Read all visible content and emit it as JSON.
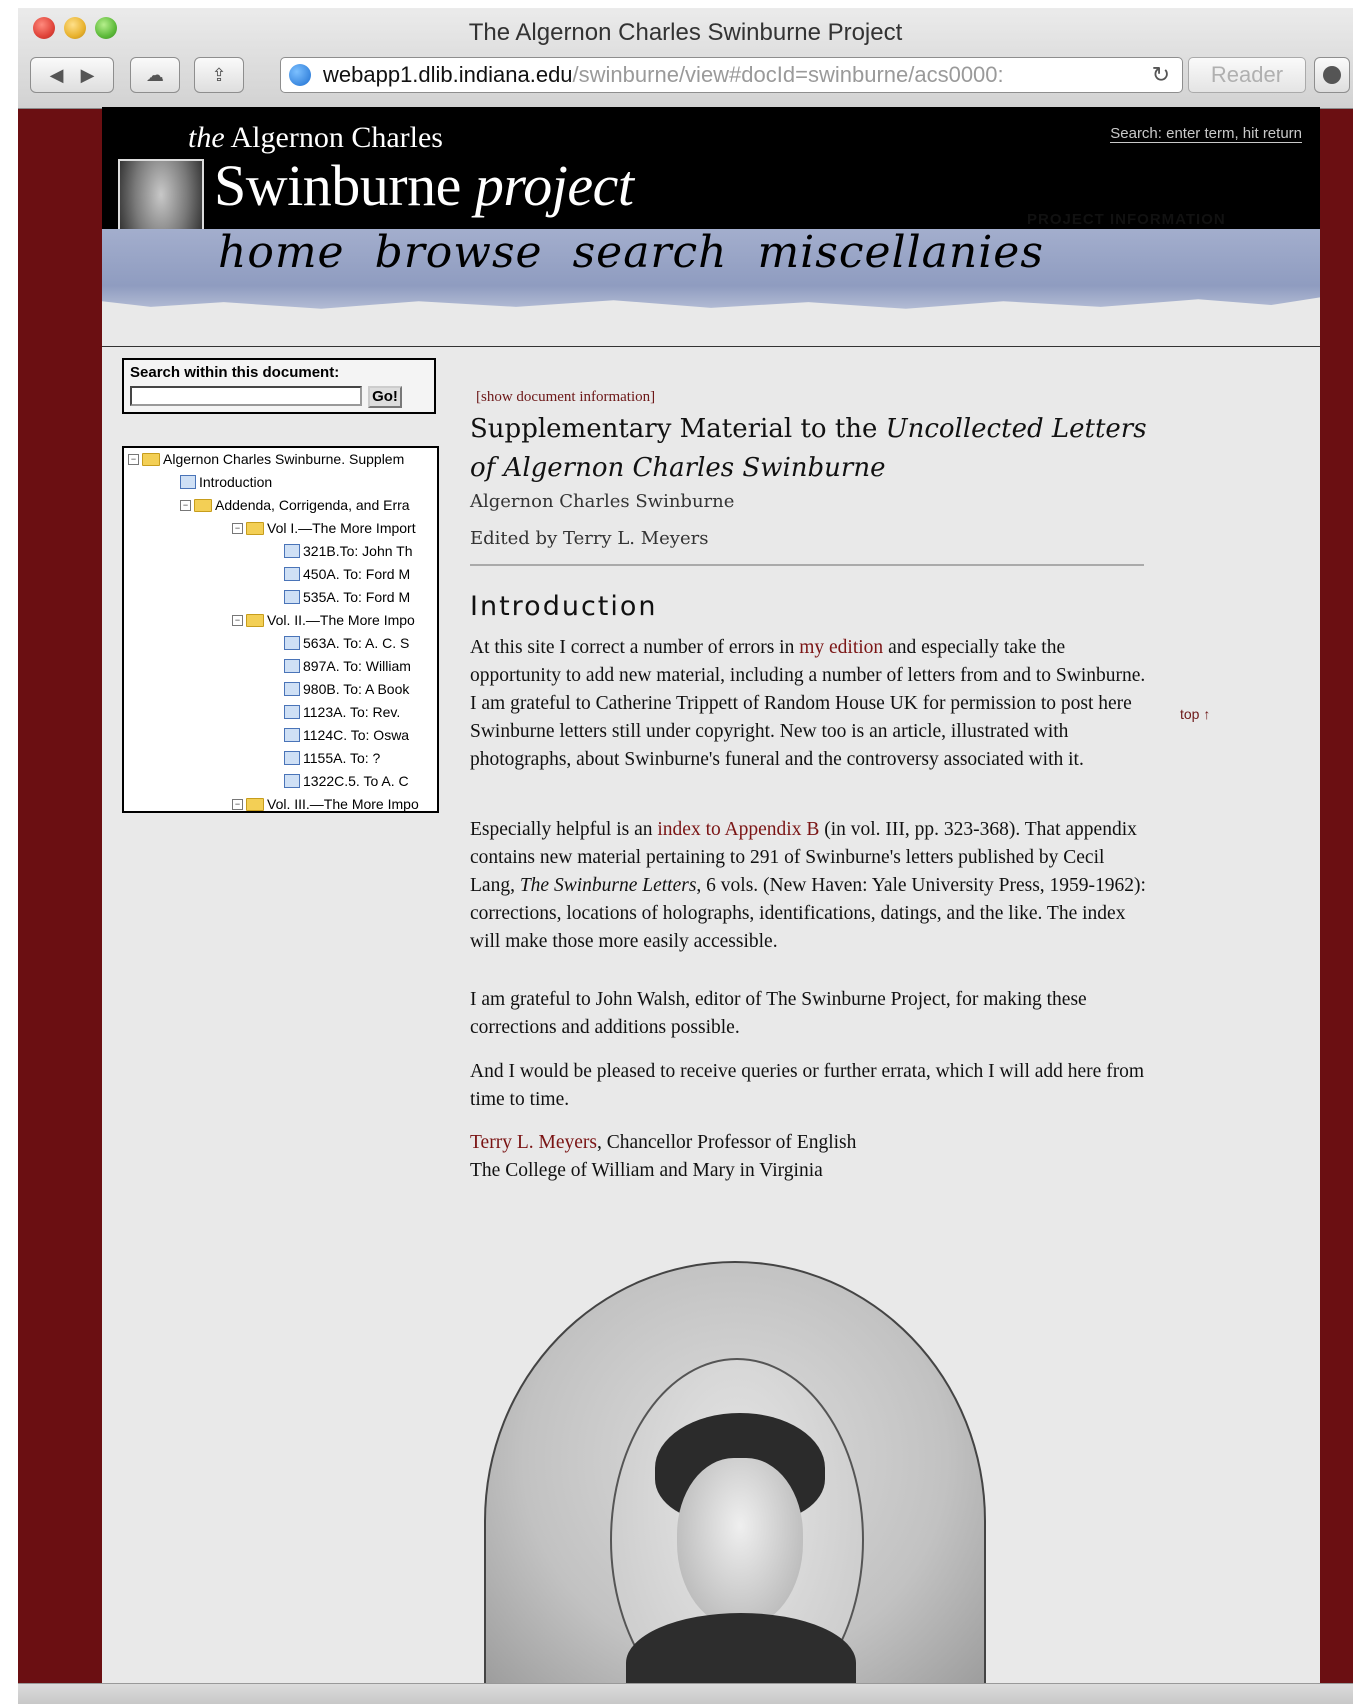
{
  "browser": {
    "window_title": "The Algernon Charles Swinburne Project",
    "url_host": "webapp1.dlib.indiana.edu",
    "url_path": "/swinburne/view#docId=swinburne/acs0000:",
    "reader_label": "Reader"
  },
  "header": {
    "the_prefix": "the",
    "name_line": "Algernon Charles",
    "logo_main": "Swinburne",
    "logo_italic": "project",
    "search_hint": "Search: enter term, hit return",
    "project_info": "PROJECT INFORMATION",
    "nav": [
      "home",
      "browse",
      "search",
      "miscellanies"
    ]
  },
  "sidebar": {
    "search_label": "Search within this document:",
    "search_value": "",
    "go_label": "Go!",
    "tree": [
      {
        "label": "Algernon Charles Swinburne. Supplem",
        "type": "folder",
        "indent": 0
      },
      {
        "label": "Introduction",
        "type": "doc",
        "indent": 1
      },
      {
        "label": "Addenda, Corrigenda, and Erra",
        "type": "folder",
        "indent": 1
      },
      {
        "label": "Vol I.—The More Import",
        "type": "folder",
        "indent": 2
      },
      {
        "label": "321B.To: John Th",
        "type": "doc",
        "indent": 3
      },
      {
        "label": "450A. To: Ford M",
        "type": "doc",
        "indent": 3
      },
      {
        "label": "535A. To: Ford M",
        "type": "doc",
        "indent": 3
      },
      {
        "label": "Vol. II.—The More Impo",
        "type": "folder",
        "indent": 2
      },
      {
        "label": "563A. To: A. C. S",
        "type": "doc",
        "indent": 3
      },
      {
        "label": "897A. To: William",
        "type": "doc",
        "indent": 3
      },
      {
        "label": "980B. To: A Book",
        "type": "doc",
        "indent": 3
      },
      {
        "label": "1123A. To: Rev.",
        "type": "doc",
        "indent": 3
      },
      {
        "label": "1124C. To: Oswa",
        "type": "doc",
        "indent": 3
      },
      {
        "label": "1155A. To: ?",
        "type": "doc",
        "indent": 3
      },
      {
        "label": "1322C.5. To A. C",
        "type": "doc",
        "indent": 3
      },
      {
        "label": "Vol. III.—The More Impo",
        "type": "folder",
        "indent": 2
      }
    ]
  },
  "content": {
    "show_doc_info": "[show document information]",
    "title_a": "Supplementary Material to the ",
    "title_italic": "Uncollected Letters of Algernon Charles Swinburne",
    "author": "Algernon Charles Swinburne",
    "editor": "Edited by Terry L. Meyers",
    "heading": "Introduction",
    "top_link": "top ↑",
    "p1_a": "At this site I correct a number of errors in ",
    "p1_link": "my edition",
    "p1_b": " and especially take the opportunity to add new material, including a number of letters from and to Swinburne. I am grateful to Catherine Trippett of Random House UK for permission to post here Swinburne letters still under copyright. New too is an article, illustrated with photographs, about Swinburne's funeral and the controversy associated with it.",
    "p2_a": "Especially helpful is an ",
    "p2_link": "index to Appendix B",
    "p2_b": " (in vol. III, pp. 323-368). That appendix contains new material pertaining to 291 of Swinburne's letters published by Cecil Lang, ",
    "p2_italic": "The Swinburne Letters",
    "p2_c": ", 6 vols. (New Haven: Yale University Press, 1959-1962): corrections, locations of holographs, identifications, datings, and the like. The index will make those more easily accessible.",
    "p3": "I am grateful to John Walsh, editor of The Swinburne Project, for making these corrections and additions possible.",
    "p4": "And I would be pleased to receive queries or further errata, which I will add here from time to time.",
    "sig_link": "Terry L. Meyers",
    "sig_rest": ", Chancellor Professor of English",
    "sig_line2": "The College of William and Mary in Virginia"
  },
  "colors": {
    "frame": "#6b0f12",
    "link": "#7a1414",
    "banner": "#8f9cc0"
  }
}
